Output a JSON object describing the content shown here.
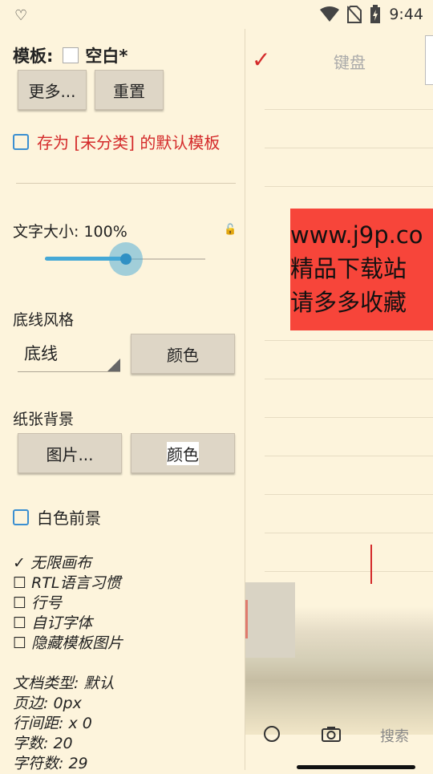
{
  "status_bar": {
    "left_icon": "heart-outline-icon",
    "time": "9:44",
    "icons": [
      "wifi-icon",
      "no-sim-icon",
      "battery-charging-icon"
    ]
  },
  "template": {
    "label": "模板:",
    "value": "空白*"
  },
  "buttons": {
    "more": "更多...",
    "reset": "重置"
  },
  "save_default": {
    "label": "存为 [未分类] 的默认模板",
    "color": "#d42a2a"
  },
  "text_size": {
    "label": "文字大小: 100%",
    "slider_fraction": 0.5
  },
  "underline": {
    "label": "底线风格",
    "selected": "底线",
    "color_button": "颜色"
  },
  "paper": {
    "label": "纸张背景",
    "image_button": "图片...",
    "color_button": "颜色"
  },
  "white_fg": {
    "label": "白色前景"
  },
  "options": [
    {
      "mark": "✓",
      "label": "无限画布"
    },
    {
      "mark": "☐",
      "label": "RTL语言习惯"
    },
    {
      "mark": "☐",
      "label": "行号"
    },
    {
      "mark": "☐",
      "label": "自订字体"
    },
    {
      "mark": "☐",
      "label": "隐藏模板图片"
    }
  ],
  "doc_info": [
    "文档类型: 默认",
    "页边: 0px",
    "行间距: x 0",
    "字数: 20",
    "字符数: 29"
  ],
  "editor": {
    "keyboard_label": "键盘",
    "text_lines": [
      "www.j9p.co",
      "精品下载站",
      "请多多收藏"
    ],
    "search_label": "搜索",
    "accent": "#d42a2a",
    "highlight": "#f7453a"
  }
}
